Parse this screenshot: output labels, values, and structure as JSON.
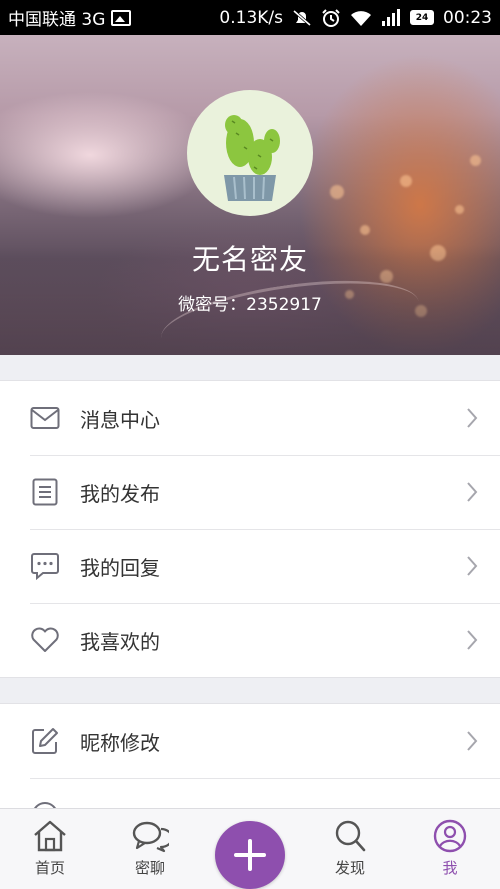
{
  "status_bar": {
    "carrier": "中国联通 3G",
    "speed": "0.13K/s",
    "battery": "24",
    "time": "00:23"
  },
  "profile": {
    "nickname": "无名密友",
    "account_id": "微密号：2352917"
  },
  "menu_group_1": [
    {
      "label": "消息中心",
      "icon": "mail-icon"
    },
    {
      "label": "我的发布",
      "icon": "document-icon"
    },
    {
      "label": "我的回复",
      "icon": "chat-bubble-icon"
    },
    {
      "label": "我喜欢的",
      "icon": "heart-icon"
    }
  ],
  "menu_group_2": [
    {
      "label": "昵称修改",
      "icon": "edit-icon"
    }
  ],
  "bottom_nav": {
    "home": "首页",
    "chat": "密聊",
    "discover": "发现",
    "me": "我"
  },
  "colors": {
    "accent": "#8e4fae",
    "icon_gray": "#6f6f7a"
  }
}
